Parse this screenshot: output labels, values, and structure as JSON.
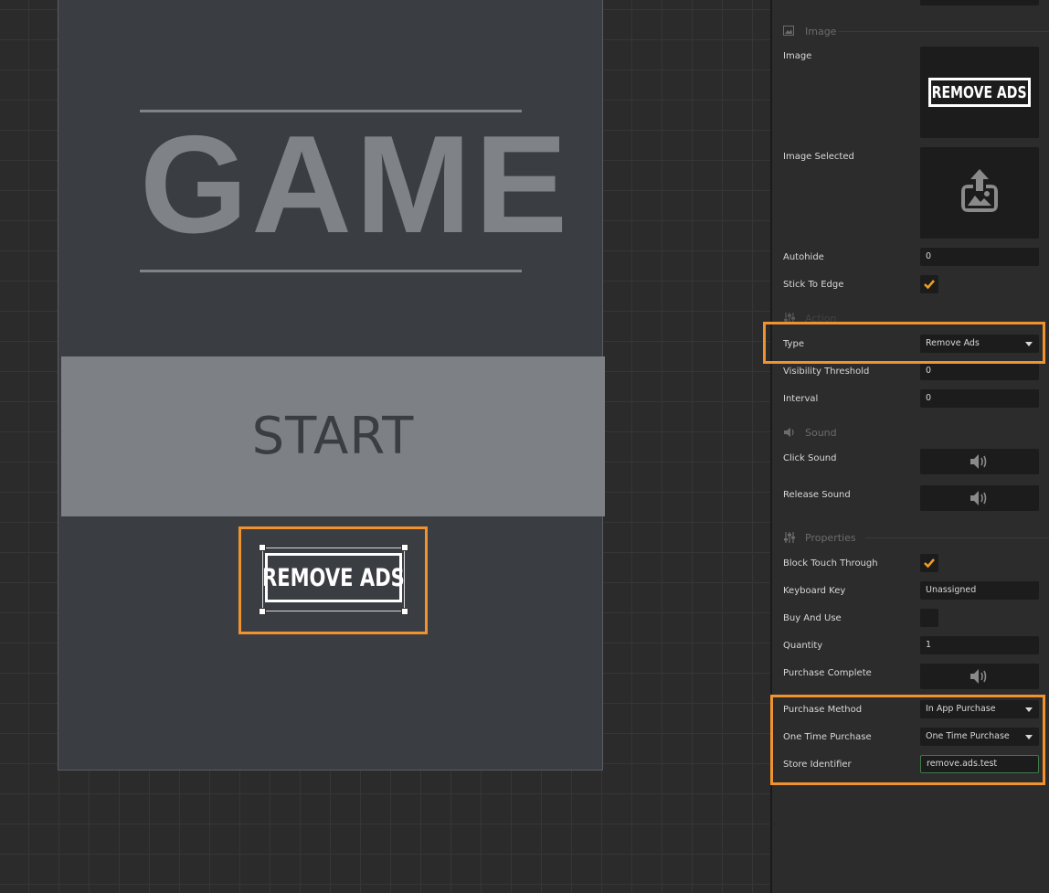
{
  "canvas": {
    "title": "GAME",
    "start_label": "START",
    "remove_ads_label": "REMOVE ADS"
  },
  "inspector": {
    "sections": {
      "image": "Image",
      "action": "Action",
      "sound": "Sound",
      "properties": "Properties"
    },
    "image": {
      "image_label": "Image",
      "image_thumb_text": "REMOVE ADS",
      "image_selected_label": "Image Selected",
      "autohide_label": "Autohide",
      "autohide_value": "0",
      "stick_to_edge_label": "Stick To Edge",
      "stick_to_edge_checked": true
    },
    "action": {
      "type_label": "Type",
      "type_value": "Remove Ads",
      "visibility_label": "Visibility Threshold",
      "visibility_value": "0",
      "interval_label": "Interval",
      "interval_value": "0"
    },
    "sound": {
      "click_label": "Click Sound",
      "release_label": "Release Sound"
    },
    "properties": {
      "block_touch_label": "Block Touch Through",
      "block_touch_checked": true,
      "keyboard_key_label": "Keyboard Key",
      "keyboard_key_value": "Unassigned",
      "buy_and_use_label": "Buy And Use",
      "buy_and_use_checked": false,
      "quantity_label": "Quantity",
      "quantity_value": "1",
      "purchase_complete_label": "Purchase Complete",
      "purchase_method_label": "Purchase Method",
      "purchase_method_value": "In App Purchase",
      "one_time_label": "One Time Purchase",
      "one_time_value": "One Time Purchase",
      "store_id_label": "Store Identifier",
      "store_id_value": "remove.ads.test"
    }
  },
  "colors": {
    "highlight": "#f0922e",
    "checkmark": "#f0a020",
    "canvas_bg": "#2b2b2b",
    "game_bg": "#3a3d42",
    "panel_bg": "#2c2c2c"
  },
  "icons": [
    "image-icon",
    "upload-image-icon",
    "action-sliders-icon",
    "sound-icon",
    "speaker-icon",
    "properties-sliders-icon",
    "checkmark-icon",
    "dropdown-arrow-icon"
  ]
}
